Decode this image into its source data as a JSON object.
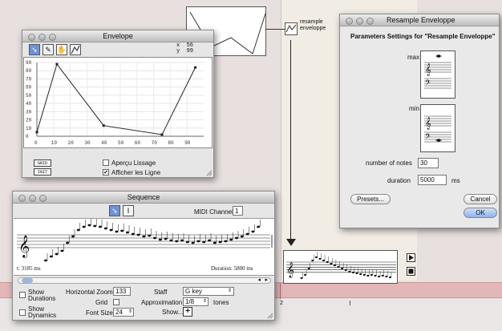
{
  "envelope": {
    "title": "Envelope",
    "coord_x_label": "x",
    "coord_x_value": "56",
    "coord_y_label": "y",
    "coord_y_value": "99",
    "grid_button": "GRID",
    "init_button": "INIT",
    "apercu_label": "Aperçu Lissage",
    "apercu_checked": false,
    "afficher_label": "Afficher les Ligne",
    "afficher_checked": true,
    "y_ticks": [
      "90",
      "80",
      "70",
      "60",
      "50",
      "40",
      "30",
      "20",
      "10",
      "0"
    ],
    "x_ticks": [
      "0",
      "10",
      "20",
      "30",
      "40",
      "50",
      "60",
      "70",
      "80",
      "90"
    ],
    "points": [
      [
        0,
        5
      ],
      [
        12,
        88
      ],
      [
        40,
        13
      ],
      [
        75,
        2
      ],
      [
        95,
        84
      ]
    ],
    "tools": [
      "arrow-tool",
      "pen-tool",
      "hand-tool",
      "curve-tool"
    ]
  },
  "resample_box": {
    "label_line1": "resample",
    "label_line2": "enveloppe"
  },
  "resample_dialog": {
    "title": "Resample Enveloppe",
    "heading": "Parameters Settings for \"Resample Enveloppe\"",
    "max_label": "max",
    "min_label": "min",
    "num_notes_label": "number of notes",
    "num_notes_value": "30",
    "duration_label": "duration",
    "duration_value": "5000",
    "duration_unit": "ms",
    "presets_button": "Presets...",
    "cancel_button": "Cancel",
    "ok_button": "OK"
  },
  "sequence": {
    "title": "Sequence",
    "midi_label": "MIDI Channel",
    "midi_value": "1",
    "start_time": "t: 3185 ms",
    "duration_text": "Duration: 5800 ms",
    "show_durations": "Show Durations",
    "show_dynamics": "Show Dynamics",
    "hzoom_label": "Horizontal Zoom",
    "hzoom_value": "133",
    "grid_label": "Grid",
    "font_size_label": "Font Size",
    "font_size_value": "24",
    "staff_label": "Staff",
    "staff_value": "G key",
    "approx_label": "Approximation",
    "approx_value": "1/8",
    "approx_unit": "tones",
    "show_label": "Show..."
  },
  "timeline": {
    "marker": "2"
  },
  "colors": {
    "accent": "#6d93d8",
    "stripe": "#e3b7b7",
    "patch_background": "#f2ede4"
  }
}
